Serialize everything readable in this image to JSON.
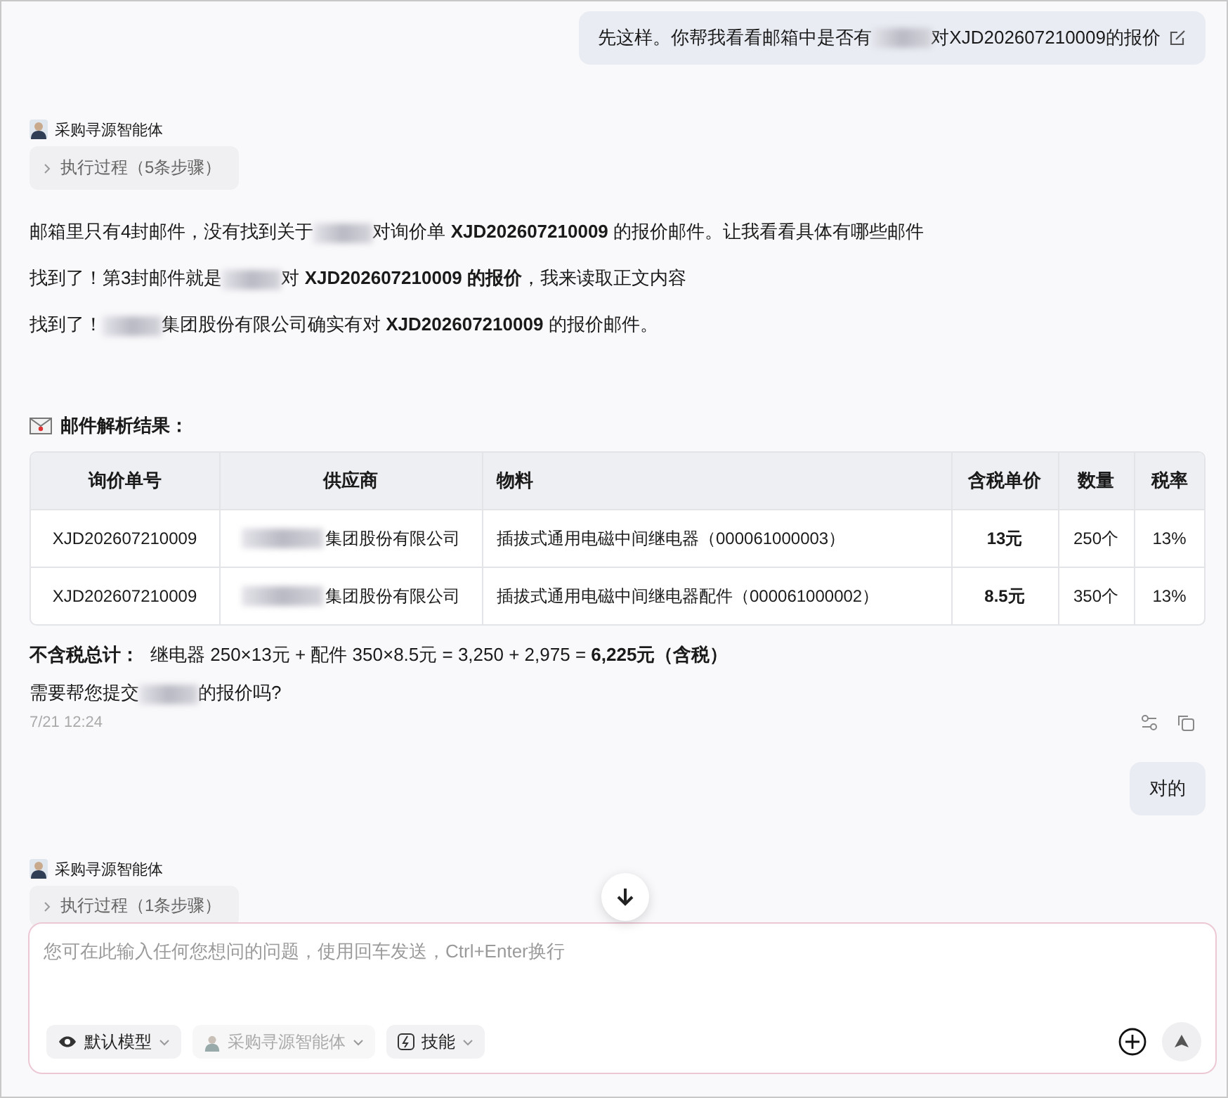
{
  "messages": [
    {
      "kind": "user",
      "parts": [
        {
          "kind": "text",
          "text": "先这样。你帮我看看邮箱中是否有"
        },
        {
          "kind": "redacted"
        },
        {
          "kind": "text",
          "text": "对XJD202607210009的报价"
        }
      ],
      "editable": true
    },
    {
      "kind": "agent",
      "agent": "采购寻源智能体",
      "steps": "执行过程（5条步骤）",
      "lines": [
        [
          {
            "kind": "text",
            "text": "邮箱里只有4封邮件，没有找到关于"
          },
          {
            "kind": "redacted"
          },
          {
            "kind": "text",
            "text": "对询价单 **XJD202607210009** 的报价邮件。让我看看具体有哪些邮件"
          }
        ],
        [
          {
            "kind": "text",
            "text": "找到了！第3封邮件就是"
          },
          {
            "kind": "redacted"
          },
          {
            "kind": "text",
            "text": "对 **XJD202607210009 的报价**，我来读取正文内容"
          }
        ],
        [
          {
            "kind": "text",
            "text": "找到了！"
          },
          {
            "kind": "redacted"
          },
          {
            "kind": "text",
            "text": "集团股份有限公司确实有对 **XJD202607210009** 的报价邮件。"
          }
        ]
      ],
      "result_heading": "邮件解析结果：",
      "table": {
        "columns": [
          "询价单号",
          "供应商",
          "物料",
          "含税单价",
          "数量",
          "税率"
        ],
        "rows": [
          [
            "XJD202607210009",
            "集团股份有限公司",
            "插拔式通用电磁中间继电器（000061000003）",
            "13元",
            "250个",
            "13%"
          ],
          [
            "XJD202607210009",
            "集团股份有限公司",
            "插拔式通用电磁中间继电器配件（000061000002）",
            "8.5元",
            "350个",
            "13%"
          ]
        ]
      },
      "total_label": "不含税总计：",
      "total_text": "继电器 250×13元 + 配件 350×8.5元 = 3,250 + 2,975 = **6,225元（含税）**",
      "question": [
        {
          "kind": "text",
          "text": "需要帮您提交"
        },
        {
          "kind": "redacted"
        },
        {
          "kind": "text",
          "text": "的报价吗?"
        }
      ],
      "time": "7/21 12:24"
    },
    {
      "kind": "user",
      "parts": [
        {
          "kind": "text",
          "text": "对的"
        }
      ],
      "editable": false
    },
    {
      "kind": "agent",
      "agent": "采购寻源智能体",
      "steps": "执行过程（1条步骤）"
    }
  ],
  "composer": {
    "placeholder": "您可在此输入任何您想问的问题，使用回车发送，Ctrl+Enter换行",
    "chips": [
      {
        "kind": "model",
        "label": "默认模型",
        "disabled": false
      },
      {
        "kind": "agent",
        "label": "采购寻源智能体",
        "disabled": true
      },
      {
        "kind": "skill",
        "label": "技能",
        "disabled": false
      }
    ]
  }
}
